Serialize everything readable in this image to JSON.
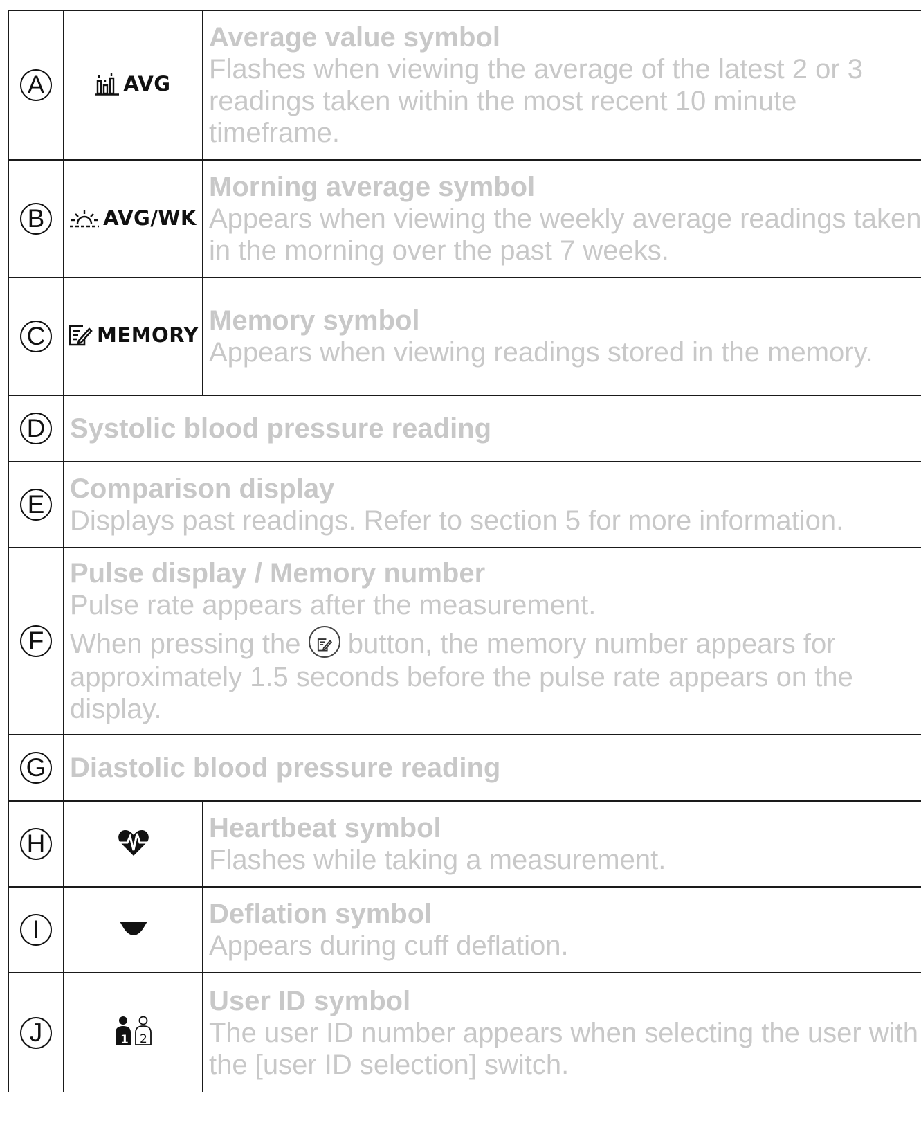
{
  "rows": [
    {
      "letter": "A",
      "symbol_icon": "bar-chart-icon",
      "symbol_text": "AVG",
      "title": "Average value symbol",
      "body": "Flashes when viewing the average of the latest 2 or 3 readings taken within the most recent 10 minute timeframe."
    },
    {
      "letter": "B",
      "symbol_icon": "sunrise-icon",
      "symbol_text": "AVG/WK",
      "title": "Morning average symbol",
      "body": "Appears when viewing the weekly average readings taken in the morning over the past 7 weeks."
    },
    {
      "letter": "C",
      "symbol_icon": "memo-icon",
      "symbol_text": "MEMORY",
      "title": "Memory symbol",
      "body": "Appears when viewing readings stored in the memory."
    },
    {
      "letter": "D",
      "title": "Systolic blood pressure reading"
    },
    {
      "letter": "E",
      "title": "Comparison display",
      "body": "Displays past readings. Refer to section 5 for more information."
    },
    {
      "letter": "F",
      "title": "Pulse display / Memory number",
      "body": "Pulse rate appears after the measurement.",
      "body2_before": "When pressing the",
      "body2_icon": "memory-button-icon",
      "body2_after": "button, the memory number appears for approximately 1.5 seconds before the pulse rate appears on the display."
    },
    {
      "letter": "G",
      "title": "Diastolic blood pressure reading"
    },
    {
      "letter": "H",
      "symbol_icon": "heartbeat-icon",
      "title": "Heartbeat symbol",
      "body": "Flashes while taking a measurement."
    },
    {
      "letter": "I",
      "symbol_icon": "deflation-icon",
      "title": "Deflation symbol",
      "body": "Appears during cuff deflation."
    },
    {
      "letter": "J",
      "symbol_icon": "user-id-icon",
      "symbol_user_1": "1",
      "symbol_user_2": "2",
      "title": "User ID symbol",
      "body": "The user ID number appears when selecting the user with the [user ID selection] switch."
    }
  ]
}
